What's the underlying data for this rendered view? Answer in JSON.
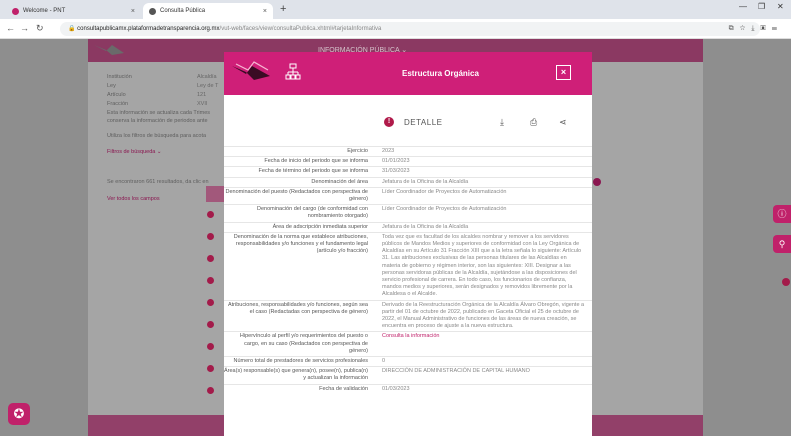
{
  "browser": {
    "tabs": [
      {
        "label": "Welcome - PNT",
        "active": false
      },
      {
        "label": "Consulta Pública",
        "active": true
      }
    ],
    "url_host": "consultapublicamx.plataformadetransparencia.org.mx",
    "url_path": "/vut-web/faces/view/consultaPublica.xhtml#tarjetaInformativa"
  },
  "background": {
    "header_title": "INFORMACIÓN PÚBLICA ⌄",
    "labels": [
      "Institución",
      "Ley",
      "Artículo",
      "Fracción"
    ],
    "values": [
      "Alcaldía",
      "Ley de T",
      "121",
      "XVII"
    ],
    "note_line1": "Esta información se actualiza cada Trimes",
    "note_line2": "conserva la información de periodos ante",
    "filter_hint": "Utiliza los filtros de búsqueda para acota",
    "filters_link": "Filtros de búsqueda ⌄",
    "results_text": "Se encontraron 661 resultados, da clic en",
    "all_fields_link": "Ver todos los campos"
  },
  "modal": {
    "title": "Estructura Orgánica",
    "close_label": "×",
    "detail_label": "DETALLE",
    "rows": [
      {
        "label": "Ejercicio",
        "value": "2023"
      },
      {
        "label": "Fecha de inicio del periodo que se informa",
        "value": "01/01/2023"
      },
      {
        "label": "Fecha de término del periodo que se informa",
        "value": "31/03/2023"
      },
      {
        "label": "Denominación del área",
        "value": "Jefatura de la Oficina de la Alcaldía"
      },
      {
        "label": "Denominación del puesto (Redactados con perspectiva de género)",
        "value": "Líder Coordinador de Proyectos de Automatización"
      },
      {
        "label": "Denominación del cargo (de conformidad con nombramiento otorgado)",
        "value": "Líder Coordinador de Proyectos de Automatización"
      },
      {
        "label": "Área de adscripción inmediata superior",
        "value": "Jefatura de la Oficina de la Alcaldía"
      },
      {
        "label": "Denominación de la norma que establece atribuciones, responsabilidades y/o funciones y el fundamento legal (artículo y/o fracción)",
        "value": "Toda vez que es facultad de los alcaldes nombrar y remover a los servidores públicos de Mandos Medios y superiores de conformidad con la Ley Orgánica de Alcaldías en su Artículo 31 Fracción XIII que a la letra señala lo siguiente: Artículo 31. Las atribuciones exclusivas de las personas titulares de las Alcaldías en materia de gobierno y régimen interior, son las siguientes: XIII. Designar a las personas servidoras públicas de la Alcaldía, sujetándose a las disposiciones del servicio profesional de carrera. En todo caso, los funcionarios de confianza, mandos medios y superiores, serán designados y removidos libremente por la Alcaldesa o el Alcalde."
      },
      {
        "label": "Atribuciones, responsabilidades y/o funciones, según sea el caso (Redactadas con perspectiva de género)",
        "value": "Derivado de la Reestructuración Orgánica de la Alcaldía Álvaro Obregón, vigente a partir del 01 de octubre de 2022, publicado en Gaceta Oficial el 25 de octubre de 2022, el Manual Administrativo de funciones de las áreas de nueva creación, se encuentra en proceso de ajuste a la nueva estructura."
      },
      {
        "label": "Hipervínculo al perfil y/o requerimientos del puesto o cargo, en su caso (Redactados con perspectiva de género)",
        "value": "Consulta la información",
        "link": true
      },
      {
        "label": "Número total de prestadores de servicios profesionales",
        "value": "0"
      },
      {
        "label": "Área(s) responsable(s) que genera(n), posee(n), publica(n) y actualizan la información",
        "value": "DIRECCIÓN DE ADMINISTRACIÓN DE CAPITAL HUMANO"
      },
      {
        "label": "Fecha de validación",
        "value": "01/03/2023"
      }
    ]
  },
  "colors": {
    "accent": "#cf1f78",
    "dark_accent": "#8a1650"
  }
}
